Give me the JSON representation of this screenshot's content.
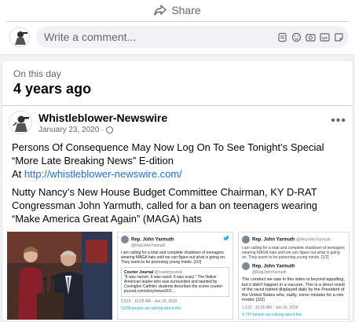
{
  "top": {
    "share_label": "Share",
    "comment_placeholder": "Write a comment..."
  },
  "memory": {
    "header_label": "On this day",
    "years_ago": "4 years ago"
  },
  "post": {
    "author": "Whistleblower-Newswire",
    "date": "January 23, 2020 ·",
    "more": "•••",
    "line1": "Persons Of Consequence May Now Log On To See Tonight’s Special “More Late Breaking News” E-dition",
    "link_prefix": "At ",
    "link_url": "http://whistleblower-newswire.com/",
    "line2": "Nutty Nancy’s New House Budget Committee Chairman, KY D-RAT Congressman John Yarmuth,  called for a ban on teenagers wearing “Make America Great Again” (MAGA) hats"
  },
  "tweet1": {
    "name": "Rep. John Yarmuth",
    "handle": "@RepJohnYarmuth",
    "body": "I am calling for a total and complete shutdown of teenagers wearing MAGA hats until we can figure out what is going on. They seem to be poisoning young minds. [1/2]",
    "quote_name": "Courier Journal",
    "quote_handle": "@courierjournal",
    "quote_body": "\"It was racism. It was racist. It was scary.\" The Native American leader who was surrounded and taunted by Covington Catholic students describes the scene courier-journal.com/story/news/201...",
    "meta": "2,519 · 10:25 AM - Jan 20, 2019",
    "footer": "9,038 people are talking about this"
  },
  "tweet2": {
    "name": "Rep. John Yarmuth",
    "handle": "@RepJohnYarmuth",
    "body": "I am calling for a total and complete shutdown of teenagers wearing MAGA hats until we can figure out what is going on. They seem to be poisoning young minds. [1/2]",
    "reply_name": "Rep. John Yarmuth",
    "reply_handle": "@RepJohnYarmuth",
    "reply_body": "The conduct we saw in this video is beyond appalling, but it didn't happen in a vacuum. This is a direct result of the racist hatred displayed daily by the President of the United States who, sadly, some mistake for a role model. [2/2]",
    "meta": "1,122 · 10:25 AM - Jan 20, 2019",
    "footer": "4,747 people are talking about this"
  },
  "icons": {
    "share": "share-arrow-icon",
    "sticker": "sticker-icon",
    "emoji": "emoji-icon",
    "camera": "camera-icon",
    "gif": "gif-icon",
    "sticker2": "comment-sticker-icon"
  },
  "colors": {
    "link": "#216fdb",
    "muted": "#65676b",
    "background": "#f0f2f5"
  }
}
